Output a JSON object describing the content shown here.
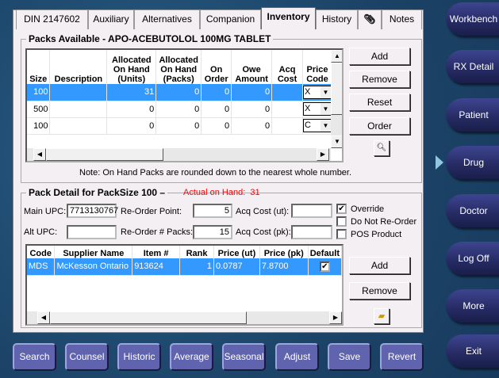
{
  "tabs": [
    {
      "label": "DIN 2147602"
    },
    {
      "label": "Auxiliary"
    },
    {
      "label": "Alternatives"
    },
    {
      "label": "Companion"
    },
    {
      "label": "Inventory"
    },
    {
      "label": "History"
    },
    {
      "label": "paperclip-icon"
    },
    {
      "label": "Notes"
    }
  ],
  "packs": {
    "title": "Packs Available - APO-ACEBUTOLOL 100MG TABLET",
    "columns": [
      "Size",
      "Description",
      "Allocated On Hand (Units)",
      "Allocated On Hand (Packs)",
      "On Order",
      "Owe Amount",
      "Acq Cost",
      "Price Code"
    ],
    "rows": [
      {
        "size": "100",
        "description": "",
        "units": "31",
        "packs": "0",
        "on_order": "0",
        "owe": "0",
        "acq": "",
        "price_code": "X",
        "selected": true
      },
      {
        "size": "500",
        "description": "",
        "units": "0",
        "packs": "0",
        "on_order": "0",
        "owe": "0",
        "acq": "",
        "price_code": "X"
      },
      {
        "size": "100",
        "description": "",
        "units": "0",
        "packs": "0",
        "on_order": "0",
        "owe": "0",
        "acq": "",
        "price_code": "C"
      }
    ],
    "buttons": {
      "add": "Add",
      "remove": "Remove",
      "reset": "Reset",
      "order": "Order"
    },
    "note": "Note: On Hand Packs are rounded down to the nearest whole number."
  },
  "detail": {
    "title": "Pack Detail for PackSize 100",
    "actual_label": "Actual on Hand:",
    "actual_value": "31",
    "main_upc_label": "Main UPC:",
    "main_upc": "7713130767",
    "alt_upc_label": "Alt UPC:",
    "alt_upc": "",
    "reorder_point_label": "Re-Order Point:",
    "reorder_point": "5",
    "reorder_packs_label": "Re-Order # Packs:",
    "reorder_packs": "15",
    "acq_ut_label": "Acq Cost (ut):",
    "acq_ut": "",
    "acq_pk_label": "Acq Cost (pk):",
    "acq_pk": "",
    "override_label": "Override",
    "override": true,
    "no_reorder_label": "Do Not Re-Order",
    "no_reorder": false,
    "pos_label": "POS Product",
    "pos": false,
    "columns": [
      "Code",
      "Supplier Name",
      "Item #",
      "Rank",
      "Price (ut)",
      "Price (pk)",
      "Default"
    ],
    "suppliers": [
      {
        "code": "MDS",
        "name": "McKesson Ontario",
        "item": "913624",
        "rank": "1",
        "price_ut": "0.0787",
        "price_pk": "7.8700",
        "default": true
      }
    ],
    "buttons": {
      "add": "Add",
      "remove": "Remove"
    }
  },
  "nav": [
    "Workbench",
    "RX Detail",
    "Patient",
    "Drug",
    "Doctor",
    "Log Off",
    "More",
    "Exit"
  ],
  "bottom": [
    "Search",
    "Counsel",
    "Historic",
    "Average",
    "Seasonal",
    "Adjust",
    "Save",
    "Revert"
  ]
}
